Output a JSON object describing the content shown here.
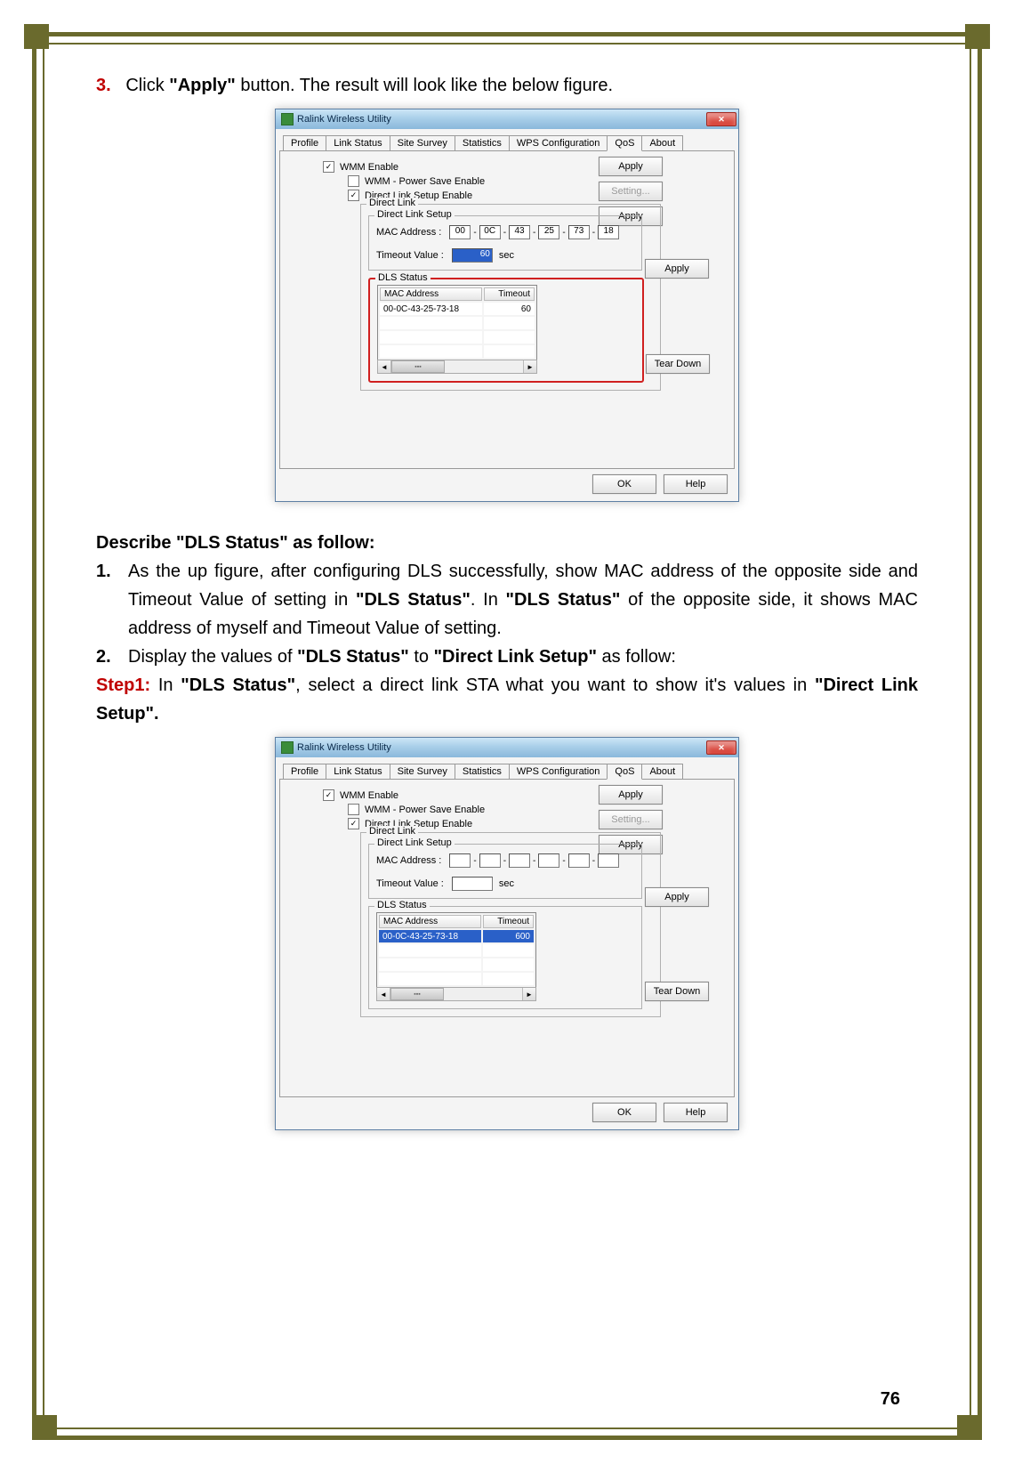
{
  "page_number": "76",
  "instr_top": {
    "num": "3.",
    "text_a": "Click ",
    "text_b": "\"Apply\"",
    "text_c": " button. The result will look like the below figure."
  },
  "describe": "Describe \"DLS Status\" as follow:",
  "list": {
    "n1": "1.",
    "t1a": "As the up figure, after configuring DLS successfully, show MAC address of the opposite side and Timeout Value of setting in ",
    "t1b": "\"DLS Status\"",
    "t1c": ". In ",
    "t1d": "\"DLS Status\"",
    "t1e": " of the opposite side, it shows MAC address of myself and Timeout Value of setting.",
    "n2": "2.",
    "t2a": "Display the values of ",
    "t2b": "\"DLS Status\"",
    "t2c": " to ",
    "t2d": "\"Direct Link Setup\"",
    "t2e": " as follow:"
  },
  "step1": {
    "label": "Step1:",
    "a": " In ",
    "b": "\"DLS Status\"",
    "c": ", select a direct link STA what you want to show it's values in ",
    "d": "\"Direct Link Setup\".",
    "e": ""
  },
  "dialog": {
    "title": "Ralink Wireless Utility",
    "tabs": [
      "Profile",
      "Link Status",
      "Site Survey",
      "Statistics",
      "WPS Configuration",
      "QoS",
      "About"
    ],
    "active_tab": "QoS",
    "wmm_enable": "WMM Enable",
    "wmm_ps": "WMM - Power Save Enable",
    "dls_enable": "Direct Link Setup Enable",
    "apply": "Apply",
    "setting": "Setting...",
    "direct_link": "Direct Link",
    "direct_link_setup": "Direct Link Setup",
    "mac_label": "MAC Address :",
    "timeout_label": "Timeout Value :",
    "sec": "sec",
    "dls_status": "DLS Status",
    "th_mac": "MAC Address",
    "th_to": "Timeout",
    "teardown": "Tear Down",
    "ok": "OK",
    "help": "Help"
  },
  "fig1": {
    "mac": [
      "00",
      "0C",
      "43",
      "25",
      "73",
      "18"
    ],
    "timeout": "60",
    "row_mac": "00-0C-43-25-73-18",
    "row_to": "60"
  },
  "fig2": {
    "mac": [
      "",
      "",
      "",
      "",
      "",
      ""
    ],
    "timeout": "",
    "row_mac": "00-0C-43-25-73-18",
    "row_to": "600"
  }
}
